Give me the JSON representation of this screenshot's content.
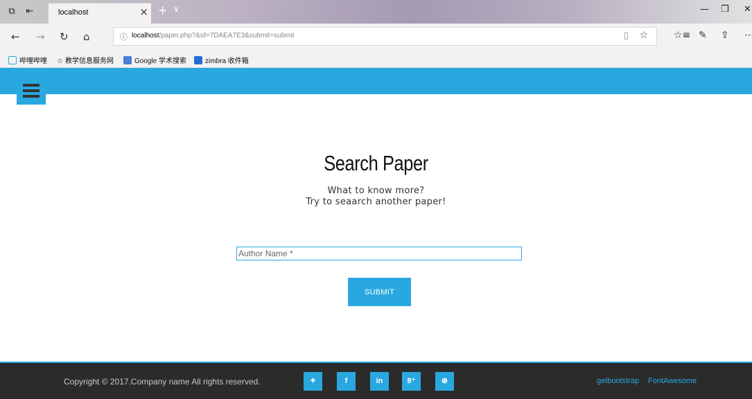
{
  "browser": {
    "tab_title": "localhost",
    "address": {
      "host": "localhost",
      "path": "/paper.php?&id=7DAEA7E3&submit=submit"
    },
    "favorites": [
      {
        "label": "哔哩哔哩",
        "icon": "bilibili-icon",
        "color": "#29a8e0"
      },
      {
        "label": "教学信息服务网",
        "icon": "star-icon",
        "color": "#333333"
      },
      {
        "label": "Google 学术搜索",
        "icon": "google-scholar-icon",
        "color": "#4a7fd8"
      },
      {
        "label": "zimbra 收件箱",
        "icon": "zimbra-icon",
        "color": "#2a6dd2"
      }
    ]
  },
  "page": {
    "heading": "Search Paper",
    "subtitle_line1": "What to know more?",
    "subtitle_line2": "Try to seaarch another paper!",
    "form": {
      "author_placeholder": "Author Name *",
      "submit_label": "SUBMIT"
    },
    "footer": {
      "copyright": "Copyright © 2017.Company name All rights reserved.",
      "social": [
        {
          "label": "twitter-icon",
          "glyph": "🐦"
        },
        {
          "label": "facebook-icon",
          "glyph": "f"
        },
        {
          "label": "linkedin-icon",
          "glyph": "in"
        },
        {
          "label": "google-plus-icon",
          "glyph": "8⁺"
        },
        {
          "label": "dribbble-icon",
          "glyph": "⊛"
        }
      ],
      "links": [
        "getbootstrap",
        "FontAwesome"
      ]
    },
    "accent_color": "#29a8e0",
    "footer_color": "#2b2b2b"
  }
}
